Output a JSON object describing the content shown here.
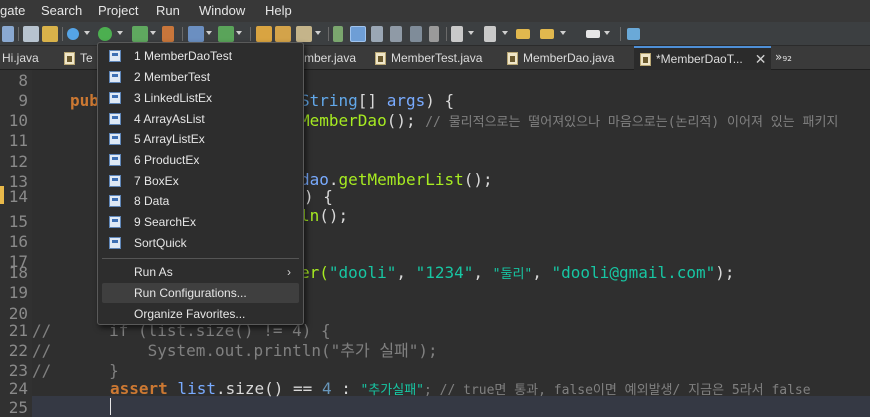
{
  "menubar": {
    "items": [
      "gate",
      "Search",
      "Project",
      "Run",
      "Window",
      "Help"
    ]
  },
  "tabs": [
    {
      "label": "Hi.java",
      "active": false
    },
    {
      "label": "Te",
      "active": false
    },
    {
      "label": "mber.java",
      "active": false
    },
    {
      "label": "MemberTest.java",
      "active": false
    },
    {
      "label": "MemberDao.java",
      "active": false
    },
    {
      "label": "*MemberDaoT...",
      "active": true
    }
  ],
  "tab_overflow": "»₉₂",
  "tab_close": "✕",
  "editor": {
    "line_numbers": [
      "8",
      "9",
      "10",
      "11",
      "12",
      "13",
      "14",
      "15",
      "16",
      "17",
      "18",
      "19",
      "20",
      "21",
      "22",
      "23",
      "24",
      "25"
    ],
    "lines": {
      "l9_a": "pub",
      "l9_b": "String",
      "l9_c": "[] ",
      "l9_d": "args",
      "l9_e": ") {",
      "l10_a": "MemberDao",
      "l10_b": "(); ",
      "l10_c": "// 물리적으로는 떨어져있으나 마음으로는(논리적) 이어져 있는 패키지",
      "l13_a": "dao",
      "l13_b": ".",
      "l13_c": "getMemberList",
      "l13_d": "();",
      "l14": ") {",
      "l15_a": "ln",
      "l15_b": "();",
      "l18_a": "er(",
      "l18_b": "\"dooli\"",
      "l18_c": ", ",
      "l18_d": "\"1234\"",
      "l18_e": ", ",
      "l18_f": "\"둘리\"",
      "l18_g": ", ",
      "l18_h": "\"dooli@gmail.com\"",
      "l18_i": ");",
      "l21_a": "//      if (list.size() != 4) {",
      "l22_a": "//          System.out.println(\"추가 실패\");",
      "l23_a": "//      }",
      "l24_a": "assert",
      "l24_b": " list",
      "l24_c": ".size() == ",
      "l24_d": "4",
      "l24_e": " : ",
      "l24_f": "\"추가실패\"",
      "l24_g": "; // true면 통과, false이면 예외발생/ 지금은 5라서 false"
    }
  },
  "run_menu": {
    "favorites": [
      "1 MemberDaoTest",
      "2 MemberTest",
      "3 LinkedListEx",
      "4 ArrayAsList",
      "5 ArrayListEx",
      "6 ProductEx",
      "7 BoxEx",
      "8 Data",
      "9 SearchEx",
      "SortQuick"
    ],
    "run_as": "Run As",
    "run_as_arrow": "›",
    "run_configurations": "Run Configurations...",
    "organize_favorites": "Organize Favorites..."
  }
}
